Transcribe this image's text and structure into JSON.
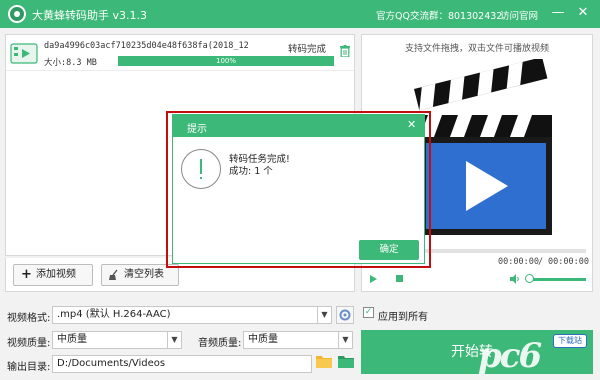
{
  "window": {
    "title": "大黄蜂转码助手 v3.1.3",
    "qq_group": "官方QQ交流群：801302432",
    "website_link": "访问官网",
    "minimize_glyph": "—",
    "close_glyph": "✕"
  },
  "file_list": {
    "items": [
      {
        "name": "da9a4996c03acf710235d04e48f638fa(2018_12",
        "size": "大小:8.3 MB",
        "status": "转码完成",
        "progress_label": "100%",
        "progress_fraction": 1.0,
        "icon": "video-file-icon"
      }
    ],
    "add_button": "添加视频",
    "add_icon": "+",
    "clear_button": "清空列表",
    "clear_icon": "broom-icon"
  },
  "preview": {
    "hint": "支持文件拖拽，双击文件可播放视频",
    "time_current": "00:00:00",
    "time_separator": "/",
    "time_total": "00:00:00",
    "image": "clapperboard-play-icon"
  },
  "settings": {
    "format_label": "视频格式:",
    "format_value": ".mp4 (默认 H.264-AAC)",
    "video_quality_label": "视频质量:",
    "video_quality_value": "中质量",
    "audio_quality_label": "音频质量:",
    "audio_quality_value": "中质量",
    "output_label": "输出目录:",
    "output_value": "D:/Documents/Videos",
    "apply_all_label": "应用到所有",
    "apply_all_checked": true,
    "start_button": "开始转"
  },
  "dialog": {
    "title": "提示",
    "message": "转码任务完成!",
    "count": "成功:  1 个",
    "ok_button": "确定",
    "close_glyph": "✕"
  },
  "watermark": {
    "text": "pc6",
    "badge": "下载站"
  },
  "colors": {
    "accent": "#3cb878",
    "highlight_frame": "#c40e0e"
  }
}
